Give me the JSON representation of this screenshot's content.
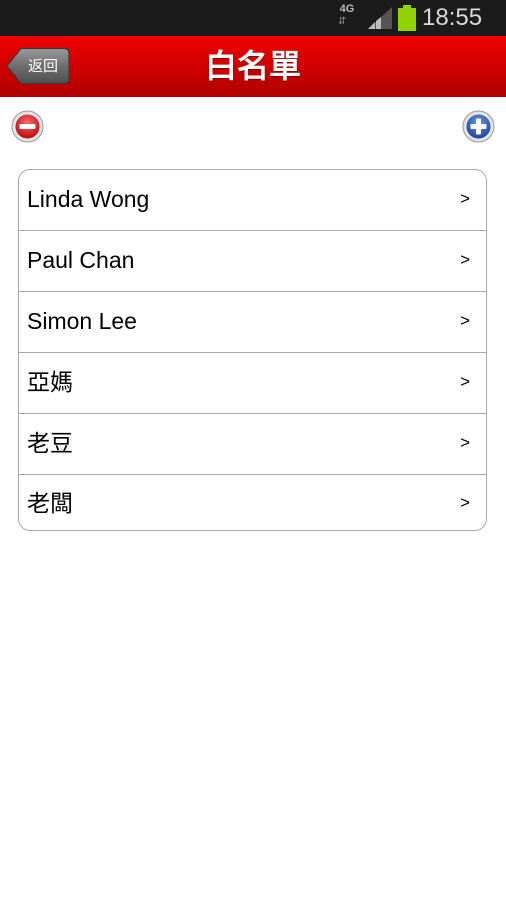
{
  "status_bar": {
    "network": "4G",
    "network_arrows": "⇵",
    "time": "18:55",
    "signal_icon": "signal-bars-icon",
    "battery_icon": "battery-icon",
    "battery_color": "#8fd400"
  },
  "header": {
    "back_label": "返回",
    "title": "白名單",
    "bar_color": "#d00000"
  },
  "toolbar": {
    "remove_icon": "minus-circle-icon",
    "add_icon": "plus-circle-icon",
    "remove_color": "#d01818",
    "add_color": "#2a56b8"
  },
  "whitelist": {
    "items": [
      {
        "name": "Linda Wong",
        "chevron": ">"
      },
      {
        "name": "Paul Chan",
        "chevron": ">"
      },
      {
        "name": "Simon Lee",
        "chevron": ">"
      },
      {
        "name": "亞媽",
        "chevron": ">"
      },
      {
        "name": "老豆",
        "chevron": ">"
      },
      {
        "name": "老闆",
        "chevron": ">"
      }
    ]
  }
}
